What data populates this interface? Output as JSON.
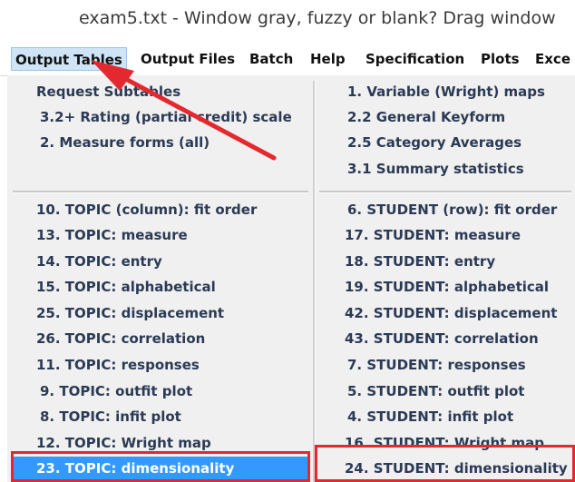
{
  "window": {
    "title": "exam5.txt - Window gray, fuzzy or blank? Drag window"
  },
  "menubar": {
    "items": [
      {
        "label": "Output Tables",
        "active": true
      },
      {
        "label": "Output Files"
      },
      {
        "label": "Batch"
      },
      {
        "label": "Help"
      },
      {
        "label": "Specification"
      },
      {
        "label": "Plots"
      },
      {
        "label": "Exce"
      }
    ]
  },
  "dropdown": {
    "left_top": [
      "Request Subtables",
      "3.2+ Rating (partial credit) scale",
      "2. Measure forms (all)"
    ],
    "right_top": [
      "1. Variable (Wright) maps",
      "2.2 General Keyform",
      "2.5 Category Averages",
      "3.1 Summary statistics"
    ],
    "left_bottom": [
      "10. TOPIC (column): fit order",
      "13. TOPIC: measure",
      "14. TOPIC: entry",
      "15. TOPIC: alphabetical",
      "25. TOPIC: displacement",
      "26. TOPIC: correlation",
      "11. TOPIC: responses",
      "9. TOPIC: outfit plot",
      "8. TOPIC: infit plot",
      "12. TOPIC: Wright map",
      "23. TOPIC: dimensionality"
    ],
    "right_bottom": [
      "6. STUDENT (row): fit order",
      "17. STUDENT: measure",
      "18. STUDENT: entry",
      "19. STUDENT: alphabetical",
      "42. STUDENT: displacement",
      "43. STUDENT: correlation",
      "7. STUDENT: responses",
      "5. STUDENT: outfit plot",
      "4. STUDENT: infit plot",
      "16. STUDENT: Wright map",
      "24. STUDENT: dimensionality"
    ]
  },
  "colors": {
    "highlight": "#3399ff",
    "annotation_red": "#e3282f",
    "item_text": "#2b3a55"
  }
}
